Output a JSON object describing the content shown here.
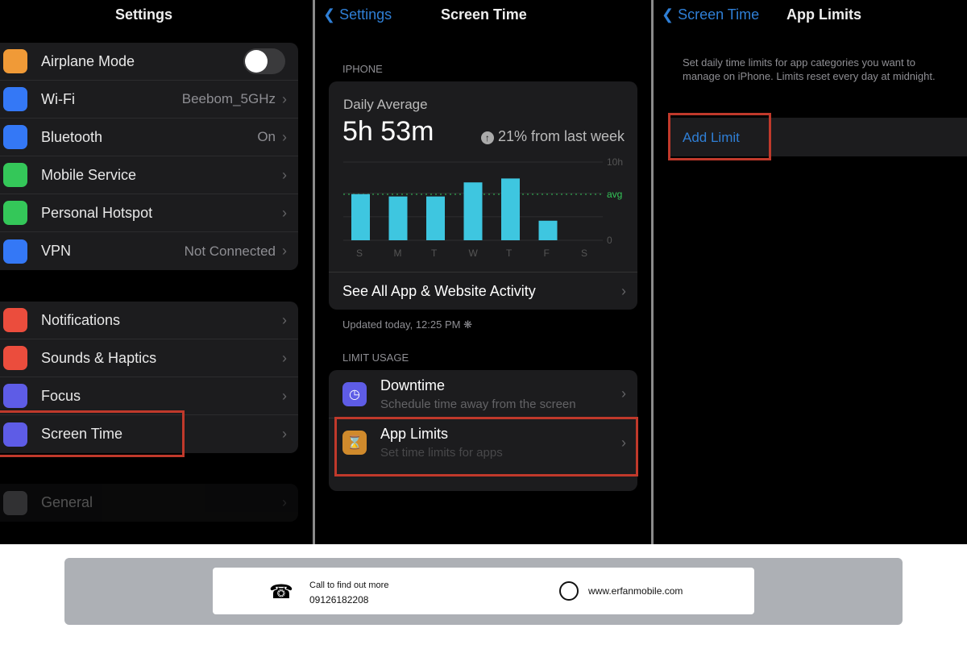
{
  "settings": {
    "title": "Settings",
    "group1": [
      {
        "label": "Airplane Mode",
        "value": "",
        "icon": "airplane-icon",
        "color": "#f09a37",
        "toggle": true
      },
      {
        "label": "Wi-Fi",
        "value": "Beebom_5GHz",
        "icon": "wifi-icon",
        "color": "#3478f6"
      },
      {
        "label": "Bluetooth",
        "value": "On",
        "icon": "bluetooth-icon",
        "color": "#3478f6"
      },
      {
        "label": "Mobile Service",
        "value": "",
        "icon": "antenna-icon",
        "color": "#34c759"
      },
      {
        "label": "Personal Hotspot",
        "value": "",
        "icon": "hotspot-icon",
        "color": "#34c759"
      },
      {
        "label": "VPN",
        "value": "Not Connected",
        "icon": "globe-icon",
        "color": "#3478f6"
      }
    ],
    "group2": [
      {
        "label": "Notifications",
        "icon": "bell-icon",
        "color": "#eb4d3d"
      },
      {
        "label": "Sounds & Haptics",
        "icon": "speaker-icon",
        "color": "#eb4d3d"
      },
      {
        "label": "Focus",
        "icon": "moon-icon",
        "color": "#5e5ce6"
      },
      {
        "label": "Screen Time",
        "icon": "hourglass-icon",
        "color": "#5e5ce6"
      }
    ],
    "group3": [
      {
        "label": "General",
        "icon": "gear-icon",
        "color": "#8e8e93"
      }
    ]
  },
  "screen_time": {
    "back": "Settings",
    "title": "Screen Time",
    "section": "IPHONE",
    "daily_label": "Daily Average",
    "daily_value": "5h 53m",
    "change": "21% from last week",
    "see_all": "See All App & Website Activity",
    "updated": "Updated today, 12:25 PM",
    "limit_section": "LIMIT USAGE",
    "downtime": {
      "title": "Downtime",
      "sub": "Schedule time away from the screen"
    },
    "app_limits": {
      "title": "App Limits",
      "sub": "Set time limits for apps"
    }
  },
  "chart_data": {
    "type": "bar",
    "categories": [
      "S",
      "M",
      "T",
      "W",
      "T",
      "F",
      "S"
    ],
    "values": [
      5.9,
      5.6,
      5.6,
      7.4,
      7.9,
      2.5,
      0
    ],
    "ylim": [
      0,
      10
    ],
    "yticks": [
      "10h",
      "avg",
      "0"
    ],
    "avg": 5.88,
    "color": "#3ec6e0",
    "avg_color": "#34c759"
  },
  "app_limits": {
    "back": "Screen Time",
    "title": "App Limits",
    "desc": "Set daily time limits for app categories you want to manage on iPhone. Limits reset every day at midnight.",
    "add": "Add Limit"
  },
  "footer": {
    "call_label": "Call to find out more",
    "phone": "09126182208",
    "website": "www.erfanmobile.com"
  }
}
